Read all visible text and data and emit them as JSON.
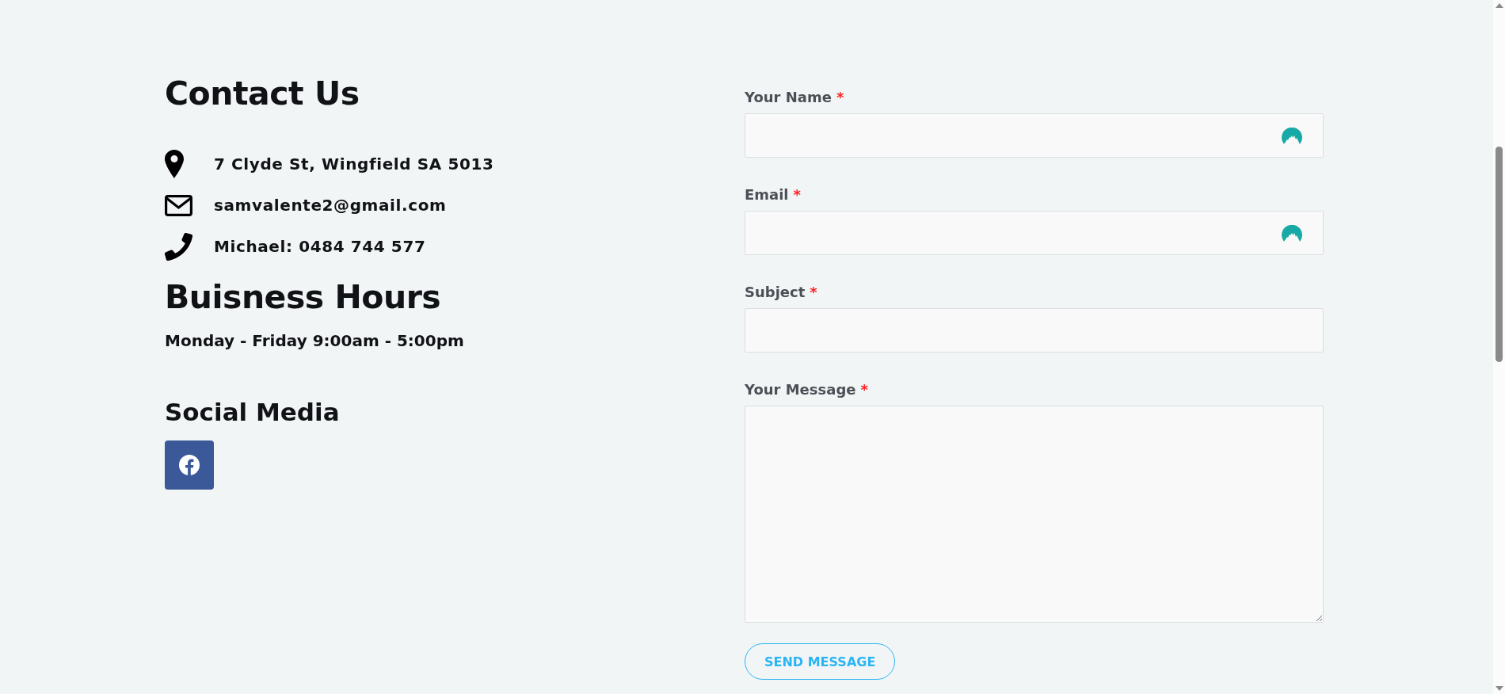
{
  "contact": {
    "title": "Contact Us",
    "items": [
      {
        "kind": "address",
        "text": "7 Clyde St, Wingfield SA 5013"
      },
      {
        "kind": "email",
        "text": "samvalente2@gmail.com"
      },
      {
        "kind": "phone",
        "text": "Michael: 0484 744 577"
      }
    ]
  },
  "hours": {
    "title": "Buisness Hours",
    "text": "Monday - Friday 9:00am - 5:00pm"
  },
  "social": {
    "title": "Social Media",
    "links": [
      {
        "kind": "facebook"
      }
    ]
  },
  "form": {
    "fields": [
      {
        "kind": "input",
        "label": "Your Name",
        "required_mark": "*",
        "autofill_icon": true
      },
      {
        "kind": "input",
        "label": "Email",
        "required_mark": "*",
        "autofill_icon": true
      },
      {
        "kind": "input",
        "label": "Subject",
        "required_mark": "*",
        "autofill_icon": false
      },
      {
        "kind": "textarea",
        "label": "Your Message",
        "required_mark": "*"
      }
    ],
    "submit": "SEND MESSAGE"
  }
}
